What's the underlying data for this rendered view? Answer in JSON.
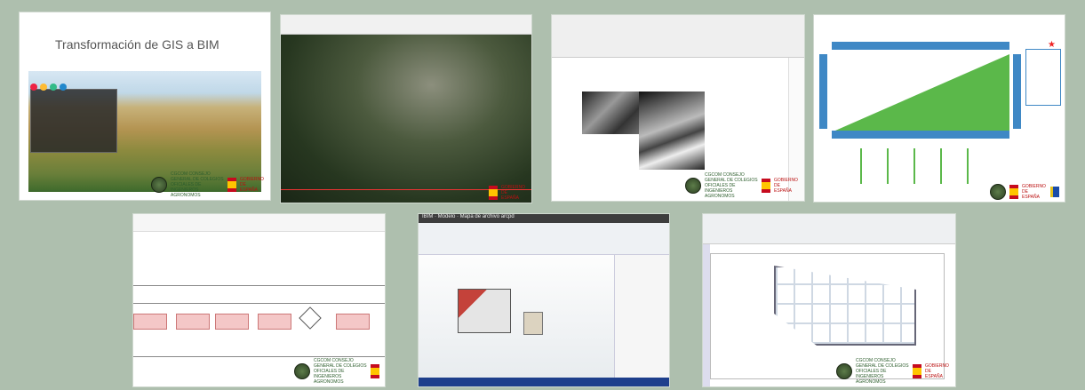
{
  "tiles": {
    "gis_to_bim": {
      "title": "Transformación de GIS a BIM"
    },
    "footer": {
      "org": "CGCOM CONSEJO GENERAL DE COLEGIOS OFICIALES DE INGENIEROS AGRONOMOS",
      "gov": "GOBIERNO DE ESPAÑA"
    },
    "revit": {
      "window_title": "IBIM · Modelo · Mapa de archivo arcpd"
    }
  }
}
